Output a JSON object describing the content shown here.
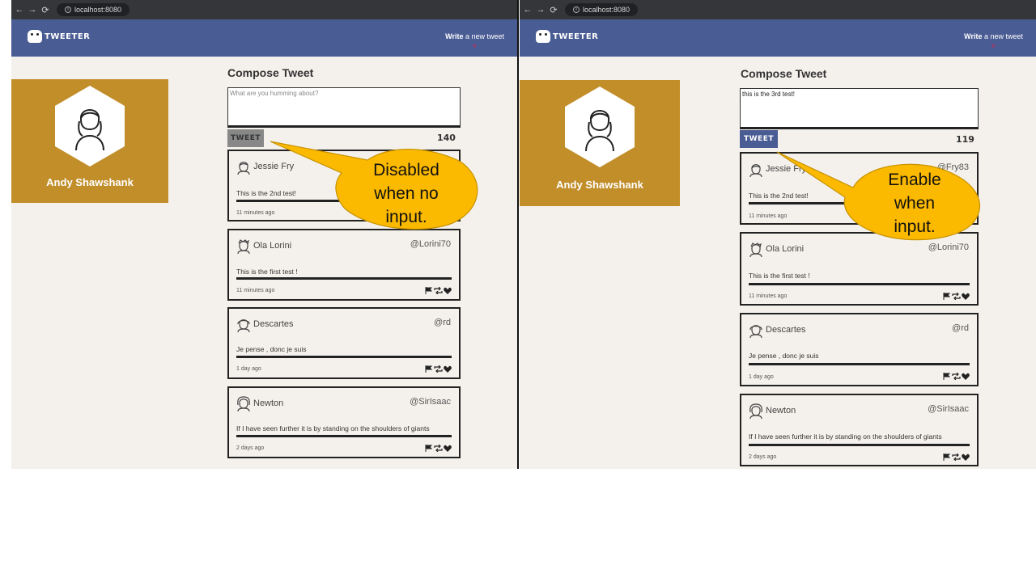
{
  "browser": {
    "url": "localhost:8080",
    "back": "←",
    "forward": "→",
    "reload": "⟳",
    "info": "i"
  },
  "header": {
    "brand": "TWEETER",
    "write_bold": "Write",
    "write_rest": " a new tweet",
    "chevron": "»"
  },
  "profile": {
    "name": "Andy Shawshank"
  },
  "compose": {
    "title": "Compose Tweet",
    "placeholder": "What are you humming about?",
    "button": "TWEET"
  },
  "left": {
    "input_value": "",
    "counter": "140",
    "button_state": "disabled"
  },
  "right": {
    "input_value": "this is the 3rd test!",
    "counter": "119",
    "button_state": "enabled"
  },
  "tweets": [
    {
      "name": "Jessie Fry",
      "handle": "@Fry83",
      "text": "This is the 2nd test!",
      "ago": "11 minutes ago"
    },
    {
      "name": "Ola Lorini",
      "handle": "@Lorini70",
      "text": "This is the first test !",
      "ago": "11 minutes ago"
    },
    {
      "name": "Descartes",
      "handle": "@rd",
      "text": "Je pense , donc je suis",
      "ago": "1 day ago"
    },
    {
      "name": "Newton",
      "handle": "@SirIsaac",
      "text": "If I have seen further it is by standing on the shoulders of giants",
      "ago": "2 days ago"
    }
  ],
  "annotations": {
    "left": [
      "Disabled",
      "when no",
      "input."
    ],
    "right": [
      "Enable",
      "when",
      "input."
    ]
  },
  "colors": {
    "navbar": "#4a5c94",
    "profile_bg": "#c18e2a",
    "callout": "#fbb900",
    "page_bg": "#f4f1ec"
  },
  "icons": [
    "user-avatar-icon",
    "flag-icon",
    "retweet-icon",
    "heart-icon",
    "chevron-down-icon"
  ]
}
